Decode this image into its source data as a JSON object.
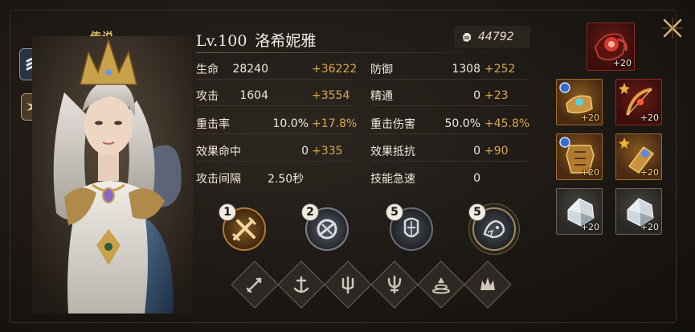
{
  "character": {
    "rarity": "传说",
    "level": "Lv.100",
    "name": "洛希妮雅",
    "power": "44792"
  },
  "stats": {
    "rows": [
      {
        "label": "生命",
        "value": "28240",
        "bonus": "+36222",
        "label2": "防御",
        "value2": "1308",
        "bonus2": "+252"
      },
      {
        "label": "攻击",
        "value": "1604",
        "bonus": "+3554",
        "label2": "精通",
        "value2": "0",
        "bonus2": "+23"
      },
      {
        "label": "重击率",
        "value": "10.0%",
        "bonus": "+17.8%",
        "label2": "重击伤害",
        "value2": "50.0%",
        "bonus2": "+45.8%"
      },
      {
        "label": "效果命中",
        "value": "0",
        "bonus": "+335",
        "label2": "效果抵抗",
        "value2": "0",
        "bonus2": "+90"
      },
      {
        "label": "攻击间隔",
        "value": "2.50秒",
        "bonus": "",
        "label2": "技能急速",
        "value2": "0",
        "bonus2": ""
      }
    ]
  },
  "skills": [
    {
      "level": "1",
      "icon": "crossed-swords-icon"
    },
    {
      "level": "2",
      "icon": "warrior-helmet-icon"
    },
    {
      "level": "5",
      "icon": "knight-mask-icon"
    },
    {
      "level": "5",
      "icon": "beast-icon"
    }
  ],
  "runes": [
    {
      "icon": "sword-rune-icon"
    },
    {
      "icon": "anchor-rune-icon"
    },
    {
      "icon": "trident-rune-icon"
    },
    {
      "icon": "crown-trident-rune-icon"
    },
    {
      "icon": "fountain-rune-icon"
    },
    {
      "icon": "crown-rune-icon"
    }
  ],
  "equipment": [
    {
      "slot": "accessory",
      "plus": "+20",
      "rarity_color": "#8a2a20",
      "icon": "red-amulet-icon"
    },
    {
      "slot": "weapon-left",
      "plus": "+20",
      "rarity_color": "#a06a2a",
      "icon": "gauntlet-icon"
    },
    {
      "slot": "weapon-right",
      "plus": "+20",
      "rarity_color": "#8a2a20",
      "icon": "bow-icon"
    },
    {
      "slot": "armor",
      "plus": "+20",
      "rarity_color": "#a06a2a",
      "icon": "armor-icon"
    },
    {
      "slot": "gloves",
      "plus": "+20",
      "rarity_color": "#a06a2a",
      "icon": "bracer-icon"
    },
    {
      "slot": "gem-1",
      "plus": "+20",
      "rarity_color": "#6b6562",
      "icon": "crystal-icon"
    },
    {
      "slot": "gem-2",
      "plus": "+20",
      "rarity_color": "#6b6562",
      "icon": "crystal-icon"
    }
  ],
  "colors": {
    "accent_gold": "#e9c46a",
    "bonus_orange": "#d9a74a",
    "text_light": "#efe9dd"
  }
}
